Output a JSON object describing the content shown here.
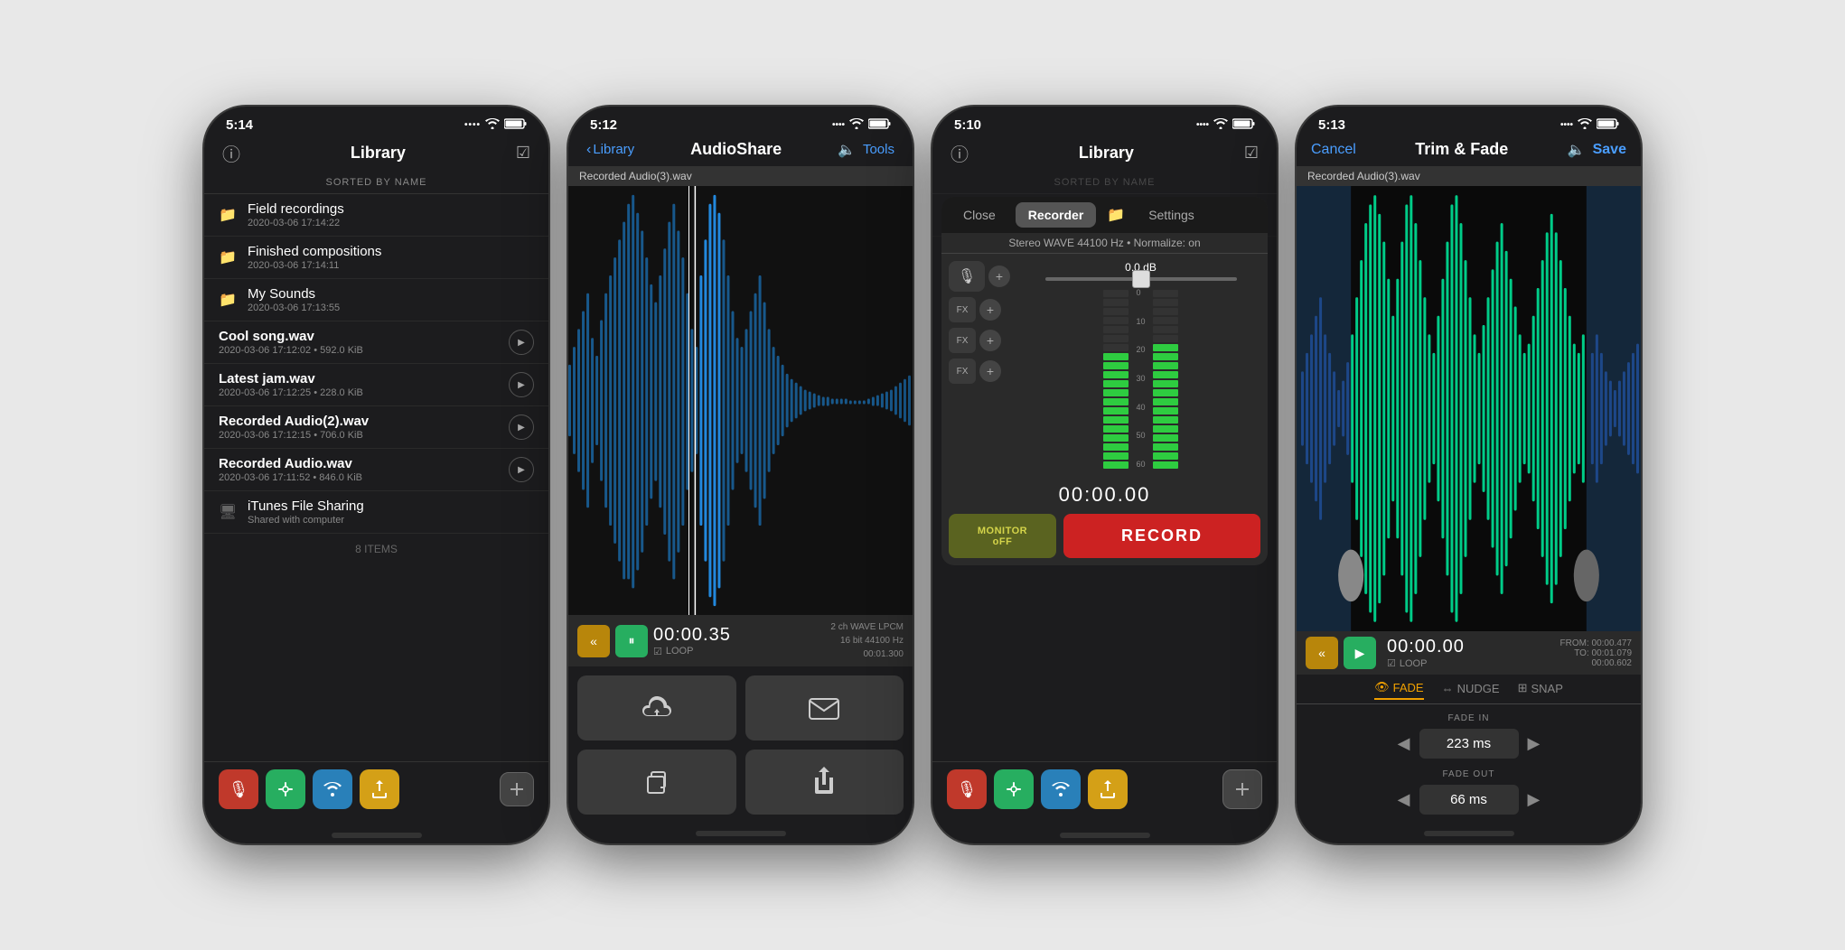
{
  "phones": [
    {
      "id": "phone1",
      "statusBar": {
        "time": "5:14",
        "signal": ".....",
        "wifi": "wifi",
        "battery": "battery"
      },
      "screen": "library",
      "navBar": {
        "leftIcon": "info-circle",
        "title": "Library",
        "rightIcon": "checkmark-square"
      },
      "sortedLabel": "SORTED BY NAME",
      "items": [
        {
          "type": "folder",
          "name": "Field recordings",
          "meta": "2020-03-06 17:14:22",
          "playable": false
        },
        {
          "type": "folder",
          "name": "Finished compositions",
          "meta": "2020-03-06 17:14:11",
          "playable": false
        },
        {
          "type": "folder",
          "name": "My Sounds",
          "meta": "2020-03-06 17:13:55",
          "playable": false
        },
        {
          "type": "file",
          "name": "Cool song.wav",
          "meta": "2020-03-06 17:12:02 • 592.0 KiB",
          "playable": true
        },
        {
          "type": "file",
          "name": "Latest jam.wav",
          "meta": "2020-03-06 17:12:25 • 228.0 KiB",
          "playable": true
        },
        {
          "type": "file",
          "name": "Recorded Audio(2).wav",
          "meta": "2020-03-06 17:12:15 • 706.0 KiB",
          "playable": true
        },
        {
          "type": "file",
          "name": "Recorded Audio.wav",
          "meta": "2020-03-06 17:11:52 • 846.0 KiB",
          "playable": true
        },
        {
          "type": "itunes",
          "name": "iTunes File Sharing",
          "meta": "Shared with computer",
          "playable": false
        }
      ],
      "itemCount": "8 ITEMS",
      "toolbar": {
        "buttons": [
          "mic",
          "tuner",
          "wifi",
          "export",
          "add"
        ]
      }
    },
    {
      "id": "phone2",
      "statusBar": {
        "time": "5:12",
        "signal": ".....",
        "wifi": "wifi",
        "battery": "battery"
      },
      "screen": "audioshare",
      "navBar": {
        "leftIcon": "back",
        "leftLabel": "Library",
        "title": "AudioShare",
        "speakerIcon": "speaker",
        "rightLabel": "Tools"
      },
      "fileLabel": "Recorded Audio(3).wav",
      "playback": {
        "time": "00:00.35",
        "info1": "2 ch WAVE LPCM",
        "info2": "16 bit 44100 Hz",
        "info3": "00:01.300",
        "loop": "☑ LOOP"
      },
      "shareButtons": [
        {
          "icon": "cloud-upload",
          "label": "cloud"
        },
        {
          "icon": "envelope",
          "label": "mail"
        },
        {
          "icon": "copy",
          "label": "duplicate"
        },
        {
          "icon": "share",
          "label": "share"
        }
      ]
    },
    {
      "id": "phone3",
      "statusBar": {
        "time": "5:10",
        "signal": ".....",
        "wifi": "wifi",
        "battery": "battery"
      },
      "screen": "recorder",
      "navBar": {
        "leftIcon": "info-circle",
        "title": "Library",
        "rightIcon": "checkmark-square"
      },
      "sortedLabel": "SORTED BY NAME",
      "recorderPopup": {
        "tabs": [
          "Close",
          "Recorder",
          "folder-icon",
          "Settings"
        ],
        "subtitle": "Stereo WAVE 44100 Hz • Normalize: on",
        "dbLabel": "0.0 dB",
        "timer": "00:00.00",
        "monitorBtn": "MONITOR\noFF",
        "recordBtn": "RECORD"
      },
      "toolbar": {
        "buttons": [
          "mic",
          "tuner",
          "wifi",
          "export",
          "add"
        ]
      }
    },
    {
      "id": "phone4",
      "statusBar": {
        "time": "5:13",
        "signal": ".....",
        "wifi": "wifi",
        "battery": "battery"
      },
      "screen": "trimfade",
      "fileLabel": "Recorded Audio(3).wav",
      "navBar": {
        "cancelLabel": "Cancel",
        "title": "Trim & Fade",
        "speakerIcon": "speaker",
        "saveLabel": "Save"
      },
      "playback": {
        "time": "00:00.00",
        "fromLabel": "FROM: 00:00.477",
        "toLabel": "TO: 00:01.079",
        "durationLabel": "00:00.602",
        "loop": "☑ LOOP"
      },
      "tabs": [
        {
          "label": "FADE",
          "icon": "eye",
          "active": true
        },
        {
          "label": "NUDGE",
          "icon": "arrows-h",
          "active": false
        },
        {
          "label": "SNAP",
          "icon": "grid",
          "active": false
        }
      ],
      "fadeIn": {
        "label": "FADE IN",
        "value": "223 ms"
      },
      "fadeOut": {
        "label": "FADE OUT",
        "value": "66 ms"
      }
    }
  ]
}
